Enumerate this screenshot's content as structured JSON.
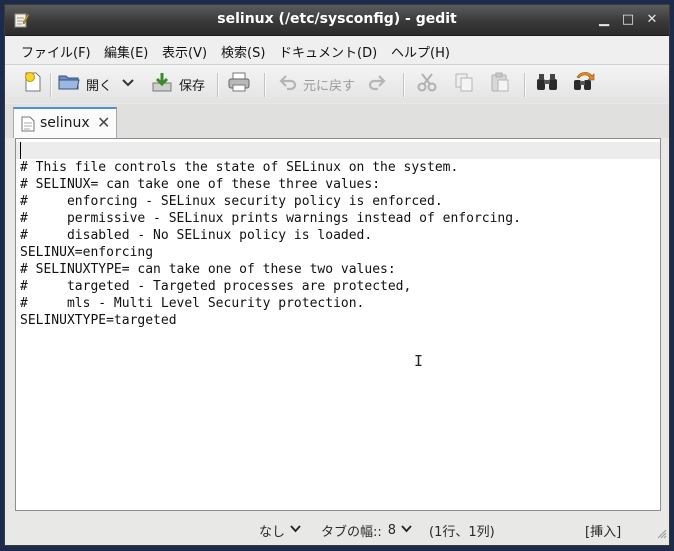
{
  "window": {
    "title": "selinux (/etc/sysconfig) - gedit"
  },
  "menu": [
    "ファイル(F)",
    "編集(E)",
    "表示(V)",
    "検索(S)",
    "ドキュメント(D)",
    "ヘルプ(H)"
  ],
  "toolbar": {
    "open_label": "開く",
    "save_label": "保存",
    "undo_label": "元に戻す"
  },
  "tab": {
    "label": "selinux"
  },
  "editor": {
    "lines": [
      "# This file controls the state of SELinux on the system.",
      "# SELINUX= can take one of these three values:",
      "#     enforcing - SELinux security policy is enforced.",
      "#     permissive - SELinux prints warnings instead of enforcing.",
      "#     disabled - No SELinux policy is loaded.",
      "SELINUX=enforcing",
      "# SELINUXTYPE= can take one of these two values:",
      "#     targeted - Targeted processes are protected,",
      "#     mls - Multi Level Security protection.",
      "SELINUXTYPE=targeted"
    ]
  },
  "status": {
    "highlight_mode": "なし",
    "tab_width_label": "タブの幅::",
    "tab_width_value": "8",
    "position": "(1行、1列)",
    "insert_mode": "[挿入]"
  },
  "colors": {
    "titlebar": "#3a3a3a",
    "tab_accent": "#4a90d9",
    "current_line": "#ececec"
  }
}
